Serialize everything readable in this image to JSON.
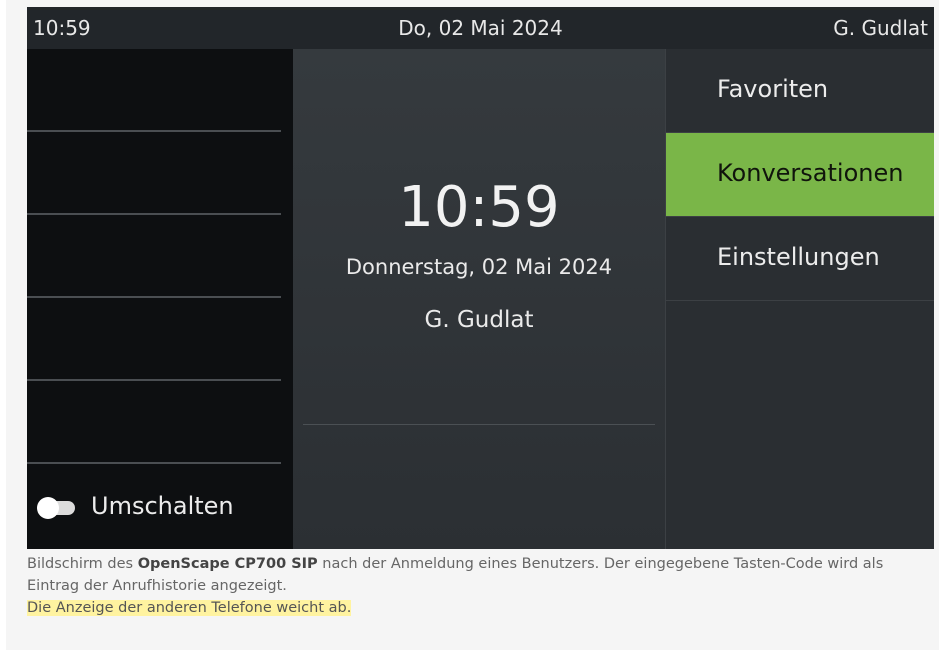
{
  "statusbar": {
    "time": "10:59",
    "date": "Do, 02 Mai 2024",
    "user": "G. Gudlat"
  },
  "left_panel": {
    "toggle_label": "Umschalten"
  },
  "center_panel": {
    "time": "10:59",
    "long_date": "Donnerstag, 02 Mai 2024",
    "user": "G. Gudlat"
  },
  "menu": {
    "items": [
      {
        "label": "Favoriten",
        "active": false
      },
      {
        "label": "Konversationen",
        "active": true
      },
      {
        "label": "Einstellungen",
        "active": false
      }
    ]
  },
  "caption": {
    "prefix": "Bildschirm des ",
    "bold": "OpenScape CP700 SIP",
    "suffix": " nach der Anmeldung eines Benutzers. Der eingegebene Tasten-Code wird als Eintrag der Anrufhistorie angezeigt.",
    "highlight": "Die Anzeige der anderen Telefone weicht ab."
  },
  "colors": {
    "accent": "#7ab648",
    "highlight": "#fff3a0"
  }
}
